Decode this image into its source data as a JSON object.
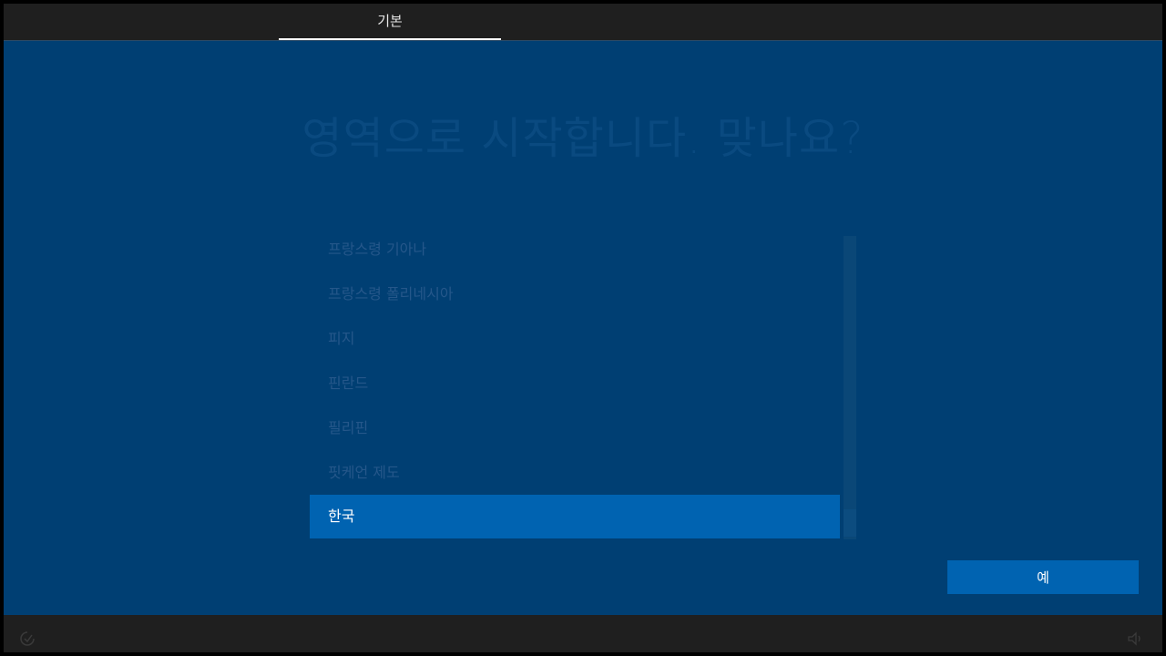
{
  "header": {
    "tabs": [
      {
        "label": "기본",
        "active": true
      }
    ]
  },
  "main": {
    "title": "영역으로 시작합니다. 맞나요?",
    "regions": [
      {
        "label": "프랑스령 기아나",
        "selected": false
      },
      {
        "label": "프랑스령 폴리네시아",
        "selected": false
      },
      {
        "label": "피지",
        "selected": false
      },
      {
        "label": "핀란드",
        "selected": false
      },
      {
        "label": "필리핀",
        "selected": false
      },
      {
        "label": "핏케언 제도",
        "selected": false
      },
      {
        "label": "한국",
        "selected": true
      }
    ],
    "yes_button": "예"
  },
  "footer": {
    "left_icon": "ease-of-access-icon",
    "right_icon": "volume-icon"
  },
  "colors": {
    "background": "#003f73",
    "bar": "#1f1f1f",
    "accent": "#0063b1"
  }
}
